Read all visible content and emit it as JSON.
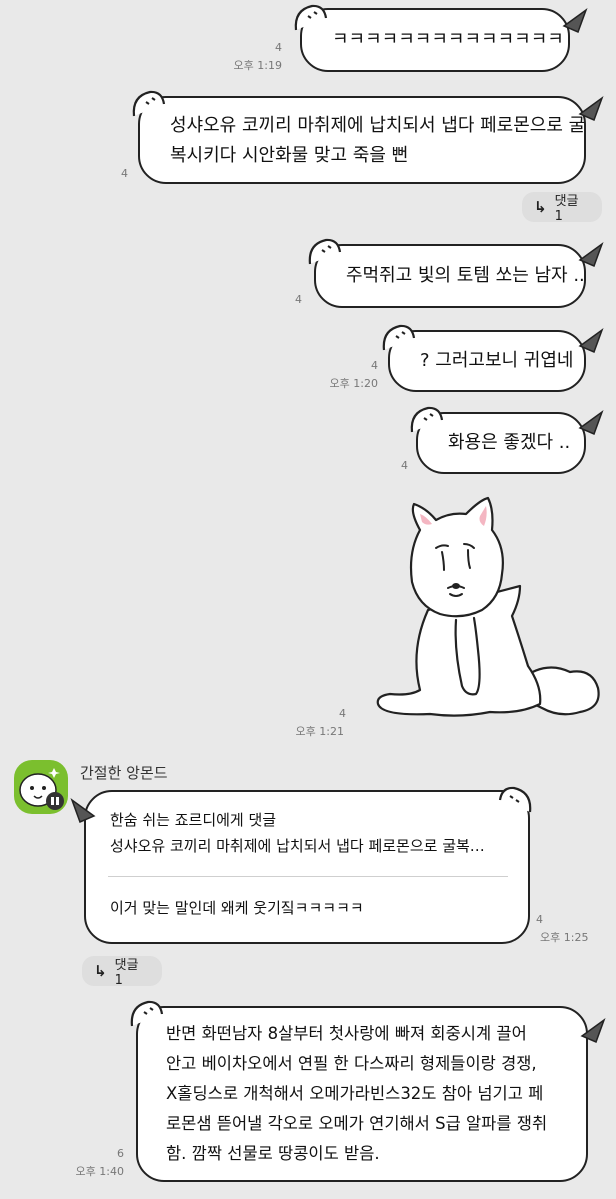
{
  "messages": [
    {
      "text": "ㅋㅋㅋㅋㅋㅋㅋㅋㅋㅋㅋㅋㅋㅋ",
      "unread": "4",
      "time": "오후 1:19"
    },
    {
      "lines": [
        "성샤오유 코끼리 마취제에 납치되서 냅다 페로몬으로 굴",
        "복시키다 시안화물 맞고 죽을 뻔"
      ],
      "unread": "4",
      "reply_label": "댓글 1"
    },
    {
      "text": "주먹쥐고 빛의 토템 쏘는 남자 ..",
      "unread": "4"
    },
    {
      "text": "? 그러고보니 귀엽네",
      "unread": "4",
      "time": "오후 1:20"
    },
    {
      "text": "화용은 좋겠다 ..",
      "unread": "4"
    },
    {
      "sticker": "sad-white-dog",
      "unread": "4",
      "time": "오후 1:21"
    }
  ],
  "incoming": {
    "sender": "간절한 앙몬드",
    "quote_line1": "한숨 쉬는 죠르디에게 댓글",
    "quote_line2": "성샤오유 코끼리 마취제에 납치되서 냅다 페로몬으로 굴복…",
    "text": "이거 맞는 말인데 왜케 웃기짘ㅋㅋㅋㅋㅋ",
    "unread": "4",
    "time": "오후 1:25",
    "reply_label": "댓글 1"
  },
  "last": {
    "lines": [
      "반면 화떤남자 8살부터 첫사랑에 빠져 회중시계 끌어",
      "안고 베이차오에서 연필 한 다스짜리 형제들이랑 경쟁,",
      "X홀딩스로 개척해서 오메가라빈스32도 참아 넘기고 페",
      "로몬샘 뜯어낼 각오로 오메가 연기해서 S급 알파를 쟁취",
      "함. 깜짝 선물로 땅콩이도 받음."
    ],
    "unread": "6",
    "time": "오후 1:40"
  },
  "colors": {
    "background": "#e9e9e9",
    "bubble": "#ffffff",
    "outline": "#222222",
    "avatar": "#7bbf2e"
  }
}
